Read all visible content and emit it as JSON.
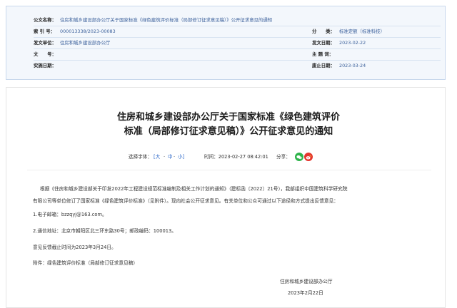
{
  "meta": {
    "doc_title_label": "公文名称：",
    "doc_title": "住房和城乡建设部办公厅关于国家标准《绿色建筑评价标准（局部修订征求意见稿）》公开征求意见的通知",
    "index_label": "索 引 号：",
    "index": "000013338/2023-00083",
    "category_label": "分　　类：",
    "category": "标准定额（标准科技）",
    "issuer_label": "发文单位：",
    "issuer": "住房和城乡建设部办公厅",
    "issue_date_label": "发文日期：",
    "issue_date": "2023-02-22",
    "doc_no_label": "文　　号：",
    "doc_no": "",
    "subject_label": "主 题 词：",
    "subject": "",
    "effective_label": "实施日期：",
    "effective": "",
    "abolish_label": "废止日期：",
    "abolish": "2023-03-24"
  },
  "article": {
    "title_line1": "住房和城乡建设部办公厅关于国家标准《绿色建筑评价",
    "title_line2": "标准（局部修订征求意见稿）》公开征求意见的通知",
    "font_select_label": "选择字体：",
    "font_large": "[大",
    "font_sep1": "·",
    "font_medium": "中",
    "font_sep2": "·",
    "font_small": "小]",
    "datetime": "时间：2023-02-27 08:42:01",
    "share_label": "分享：",
    "para1_line1": "根据《住房和城乡建设部关于印发2022年工程建设规范标准编制及相关工作计划的通知》（建标函〔2022〕21号），我部组织中国建筑科学研究院",
    "para1_line2": "有限公司等单位修订了国家标准《绿色建筑评价标准》（见附件）。现向社会公开征求意见。有关单位和公众可通过以下途径和方式提出反馈意见：",
    "email_line": "1.电子邮箱：bzzqyj@163.com。",
    "address_line": "2.通信地址：北京市朝阳区北三环东路30号；邮政编码：100013。",
    "deadline_line": "意见反馈截止时间为2023年3月24日。",
    "attachment_line": "附件：绿色建筑评价标准（局部修订征求意见稿）",
    "signer": "住房和城乡建设部办公厅",
    "sign_date": "2023年2月22日"
  },
  "colors": {
    "meta_bg": "#f3f7fc",
    "meta_value": "#3a5f9a",
    "link": "#2a66c8",
    "wechat": "#2eb34a",
    "weibo": "#e3352c"
  },
  "icons": {
    "wechat": "wechat-share-icon",
    "weibo": "weibo-share-icon"
  }
}
